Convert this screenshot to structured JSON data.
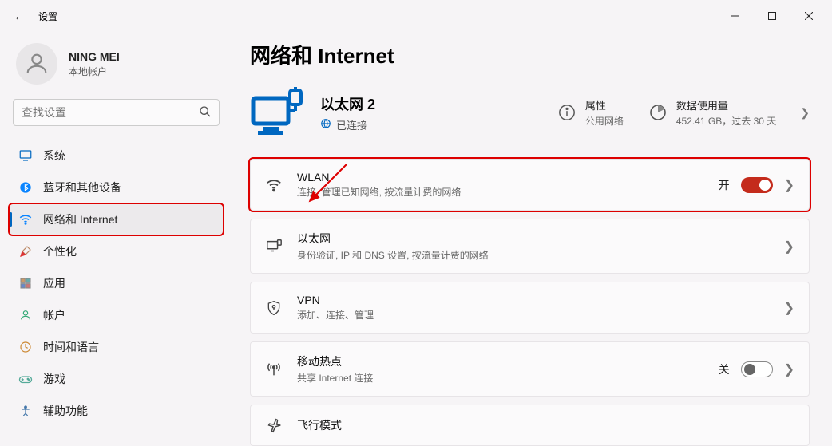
{
  "titlebar": {
    "back_label": "←",
    "title": "设置"
  },
  "profile": {
    "name": "NING MEI",
    "subtitle": "本地帐户"
  },
  "search": {
    "placeholder": "查找设置"
  },
  "nav": {
    "items": [
      {
        "label": "系统"
      },
      {
        "label": "蓝牙和其他设备"
      },
      {
        "label": "网络和 Internet"
      },
      {
        "label": "个性化"
      },
      {
        "label": "应用"
      },
      {
        "label": "帐户"
      },
      {
        "label": "时间和语言"
      },
      {
        "label": "游戏"
      },
      {
        "label": "辅助功能"
      }
    ]
  },
  "page": {
    "title": "网络和 Internet",
    "status": {
      "connection_label": "以太网 2",
      "connection_sub": "已连接",
      "properties_label": "属性",
      "properties_sub": "公用网络",
      "data_label": "数据使用量",
      "data_sub": "452.41 GB，过去 30 天"
    },
    "cards": {
      "wlan": {
        "label": "WLAN",
        "sub": "连接, 管理已知网络, 按流量计费的网络",
        "toggle_state": "开"
      },
      "ethernet": {
        "label": "以太网",
        "sub": "身份验证, IP 和 DNS 设置, 按流量计费的网络"
      },
      "vpn": {
        "label": "VPN",
        "sub": "添加、连接、管理"
      },
      "hotspot": {
        "label": "移动热点",
        "sub": "共享 Internet 连接",
        "toggle_state": "关"
      },
      "airplane": {
        "label": "飞行模式"
      }
    }
  }
}
